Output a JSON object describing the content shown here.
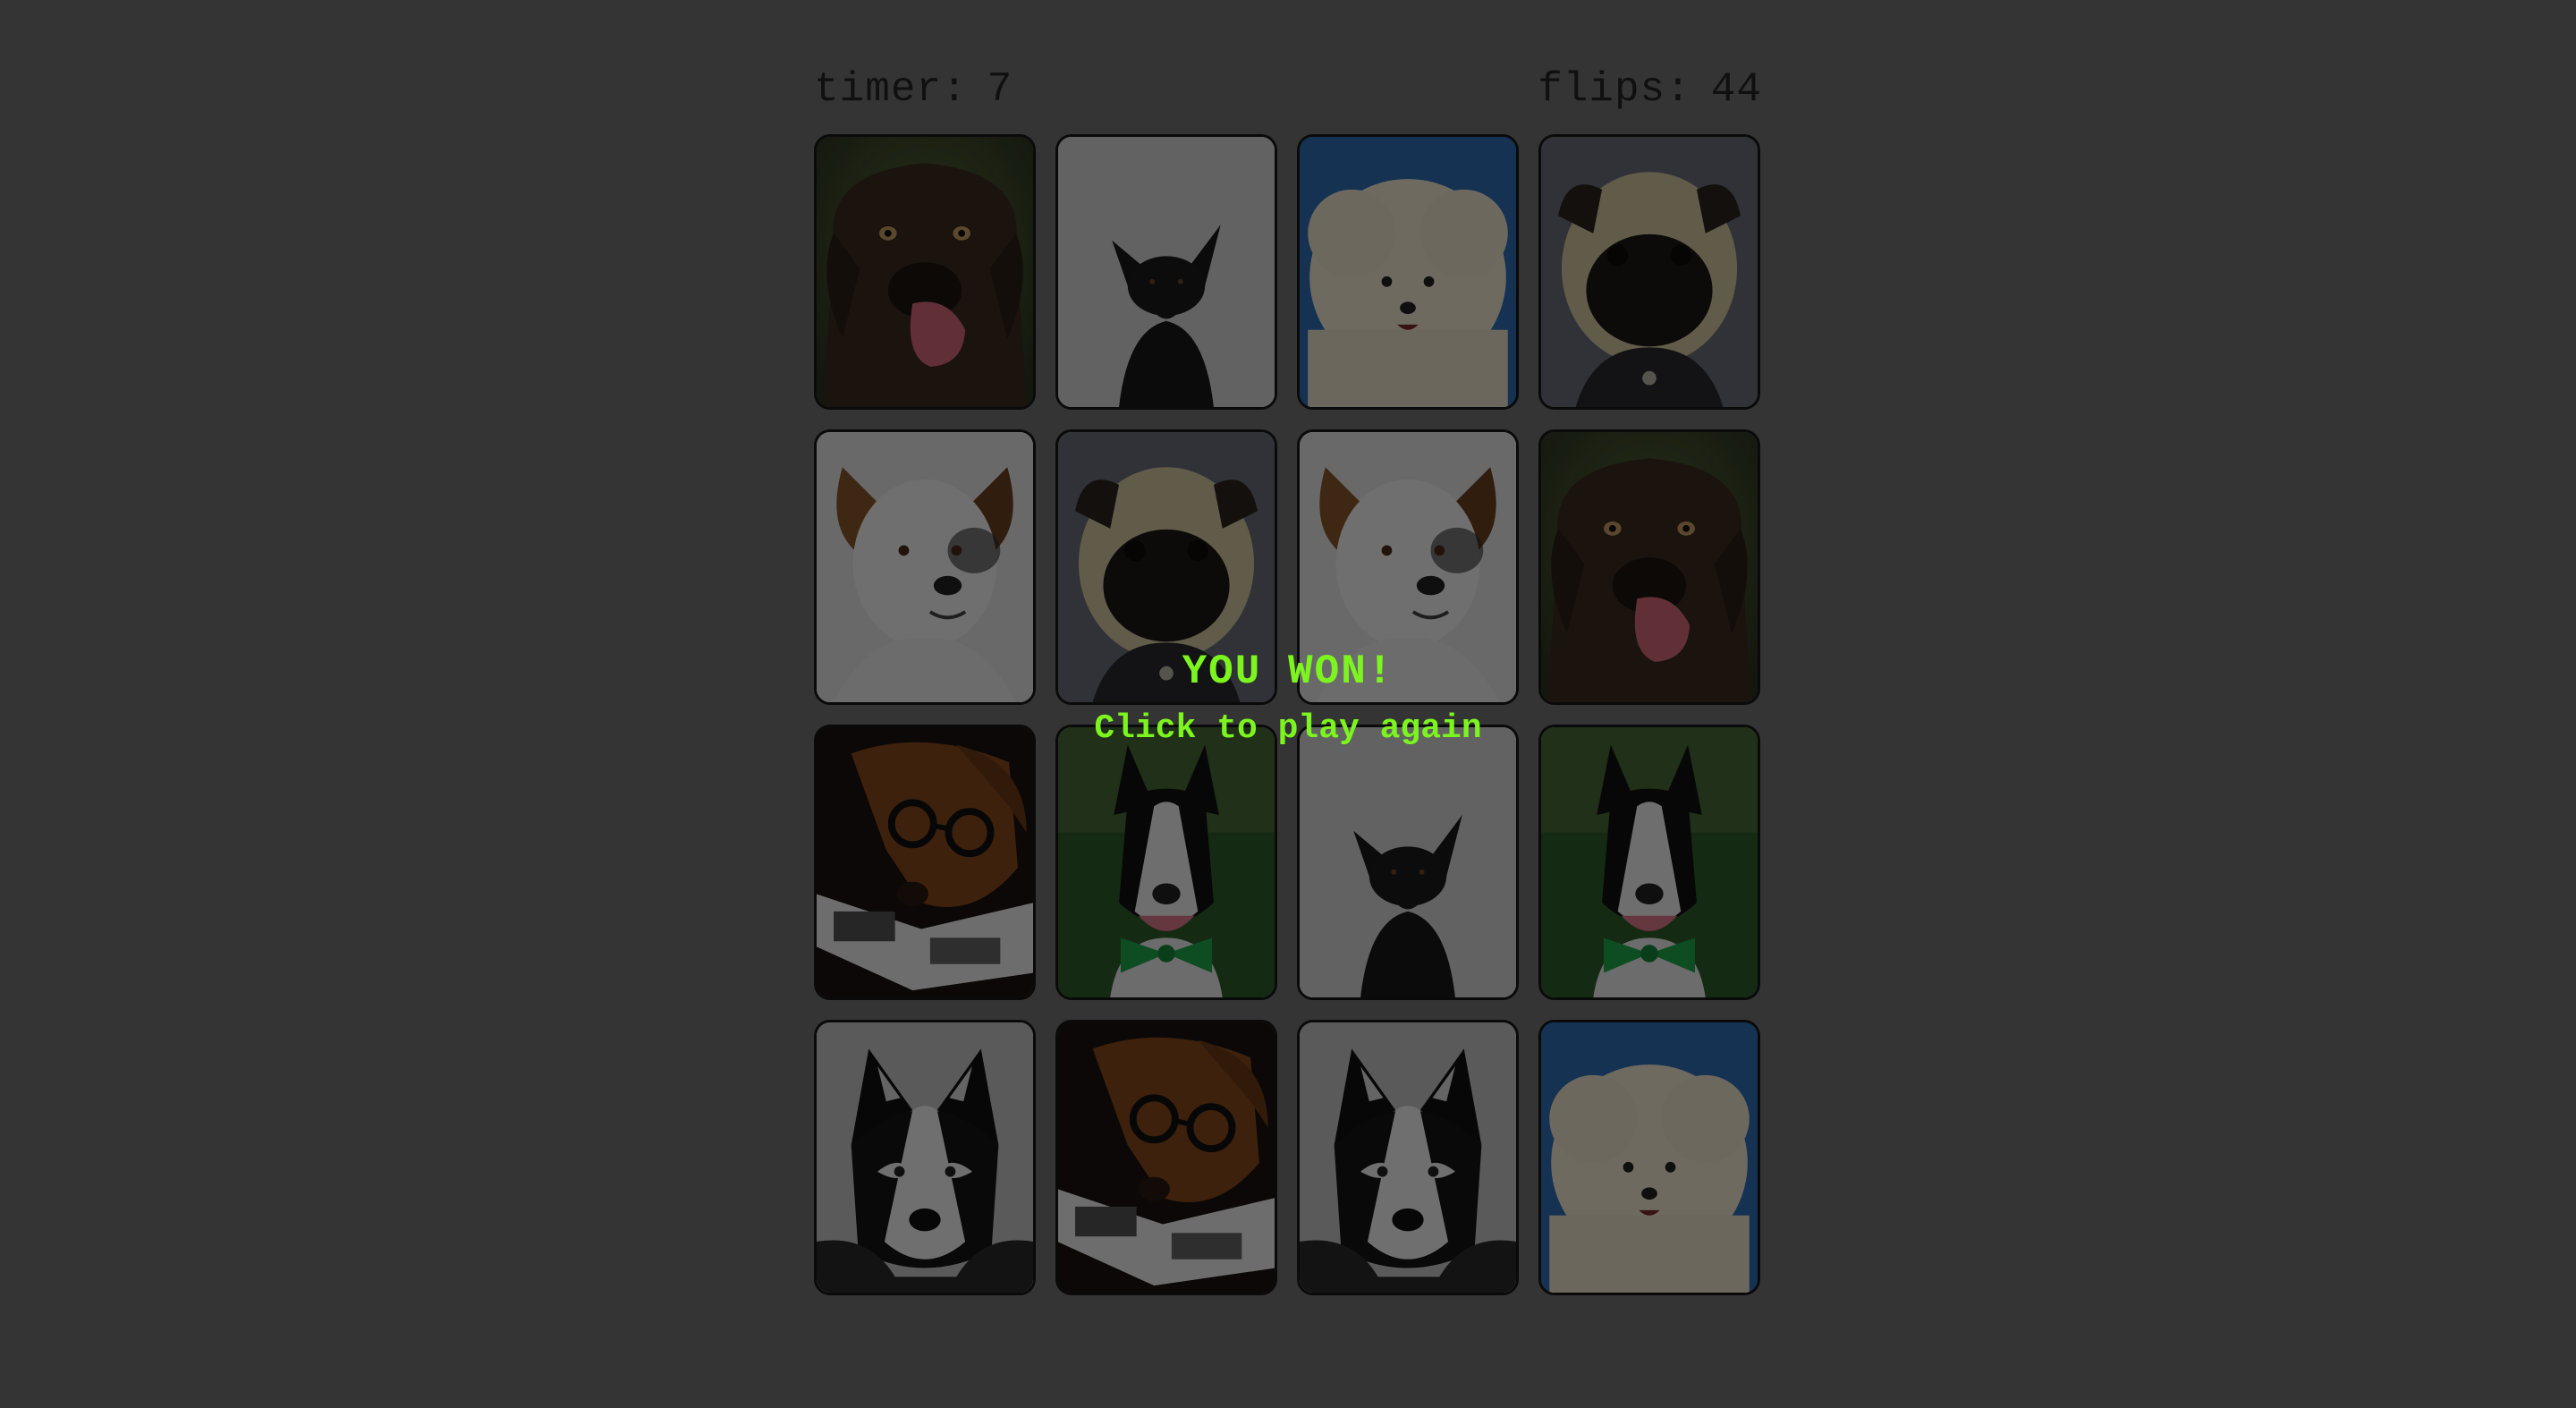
{
  "stats": {
    "timer_label": "timer:",
    "timer_value": "7",
    "flips_label": "flips:",
    "flips_value": "44"
  },
  "board": {
    "cards": [
      {
        "breed": "chocolate-lab"
      },
      {
        "breed": "black-kelpie"
      },
      {
        "breed": "bichon"
      },
      {
        "breed": "pug"
      },
      {
        "breed": "jack-russell"
      },
      {
        "breed": "pug"
      },
      {
        "breed": "jack-russell"
      },
      {
        "breed": "chocolate-lab"
      },
      {
        "breed": "dachshund-glasses"
      },
      {
        "breed": "bull-terrier"
      },
      {
        "breed": "black-kelpie"
      },
      {
        "breed": "bull-terrier"
      },
      {
        "breed": "husky"
      },
      {
        "breed": "dachshund-glasses"
      },
      {
        "breed": "husky"
      },
      {
        "breed": "bichon"
      }
    ]
  },
  "overlay": {
    "title": "YOU WON!",
    "subtitle": "Click to play again"
  },
  "colors": {
    "background": "#343434",
    "overlay_text": "#7cf51f",
    "stats_text": "#101010"
  }
}
